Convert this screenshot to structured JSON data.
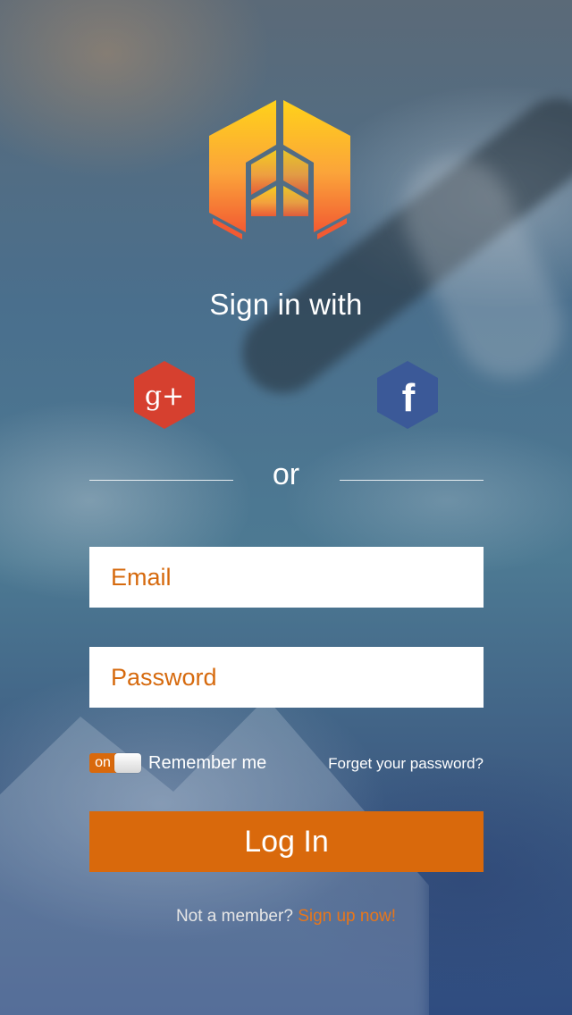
{
  "app": {
    "logo_icon": "hexagon-a-logo-icon",
    "brand_colors": {
      "accent": "#d9690c",
      "logo_top": "#ffd21a",
      "logo_bottom": "#f25a32",
      "google": "#d6402f",
      "facebook": "#3b5998"
    }
  },
  "signin": {
    "title": "Sign in with",
    "google_icon": "google-plus-icon",
    "google_glyph": "g+",
    "facebook_icon": "facebook-icon",
    "facebook_glyph": "f",
    "divider_text": "or"
  },
  "form": {
    "email_placeholder": "Email",
    "password_placeholder": "Password",
    "remember_toggle_state": "on",
    "remember_label": "Remember me",
    "forgot_link": "Forget your password?",
    "login_label": "Log In"
  },
  "footer": {
    "text": "Not a member?",
    "signup_link": "Sign up now!"
  }
}
